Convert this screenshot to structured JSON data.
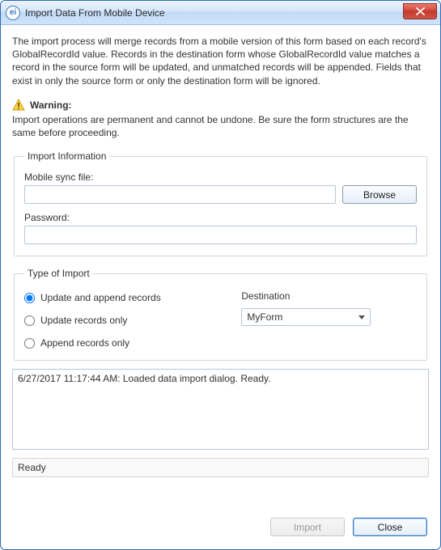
{
  "window": {
    "title": "Import Data From Mobile Device",
    "app_icon_text": "ei"
  },
  "description": "The import process will merge records from a mobile version of this form based on each record's GlobalRecordId value. Records in the destination form whose GlobalRecordId value matches a record in the source form will be updated, and unmatched records will be appended. Fields that exist in only the source form or only the destination form will be ignored.",
  "warning": {
    "label": "Warning:",
    "text": "Import operations are permanent and cannot be undone. Be sure the form structures are the same before proceeding."
  },
  "import_info": {
    "legend": "Import Information",
    "file_label": "Mobile sync file:",
    "file_value": "",
    "browse_label": "Browse",
    "password_label": "Password:",
    "password_value": ""
  },
  "type_of_import": {
    "legend": "Type of Import",
    "options": {
      "update_append": "Update and append records",
      "update_only": "Update records only",
      "append_only": "Append records only"
    },
    "selected": "update_append",
    "destination_label": "Destination",
    "destination_value": "MyForm"
  },
  "log": "6/27/2017 11:17:44 AM: Loaded data import dialog. Ready.",
  "status": "Ready",
  "buttons": {
    "import": "Import",
    "close": "Close"
  }
}
